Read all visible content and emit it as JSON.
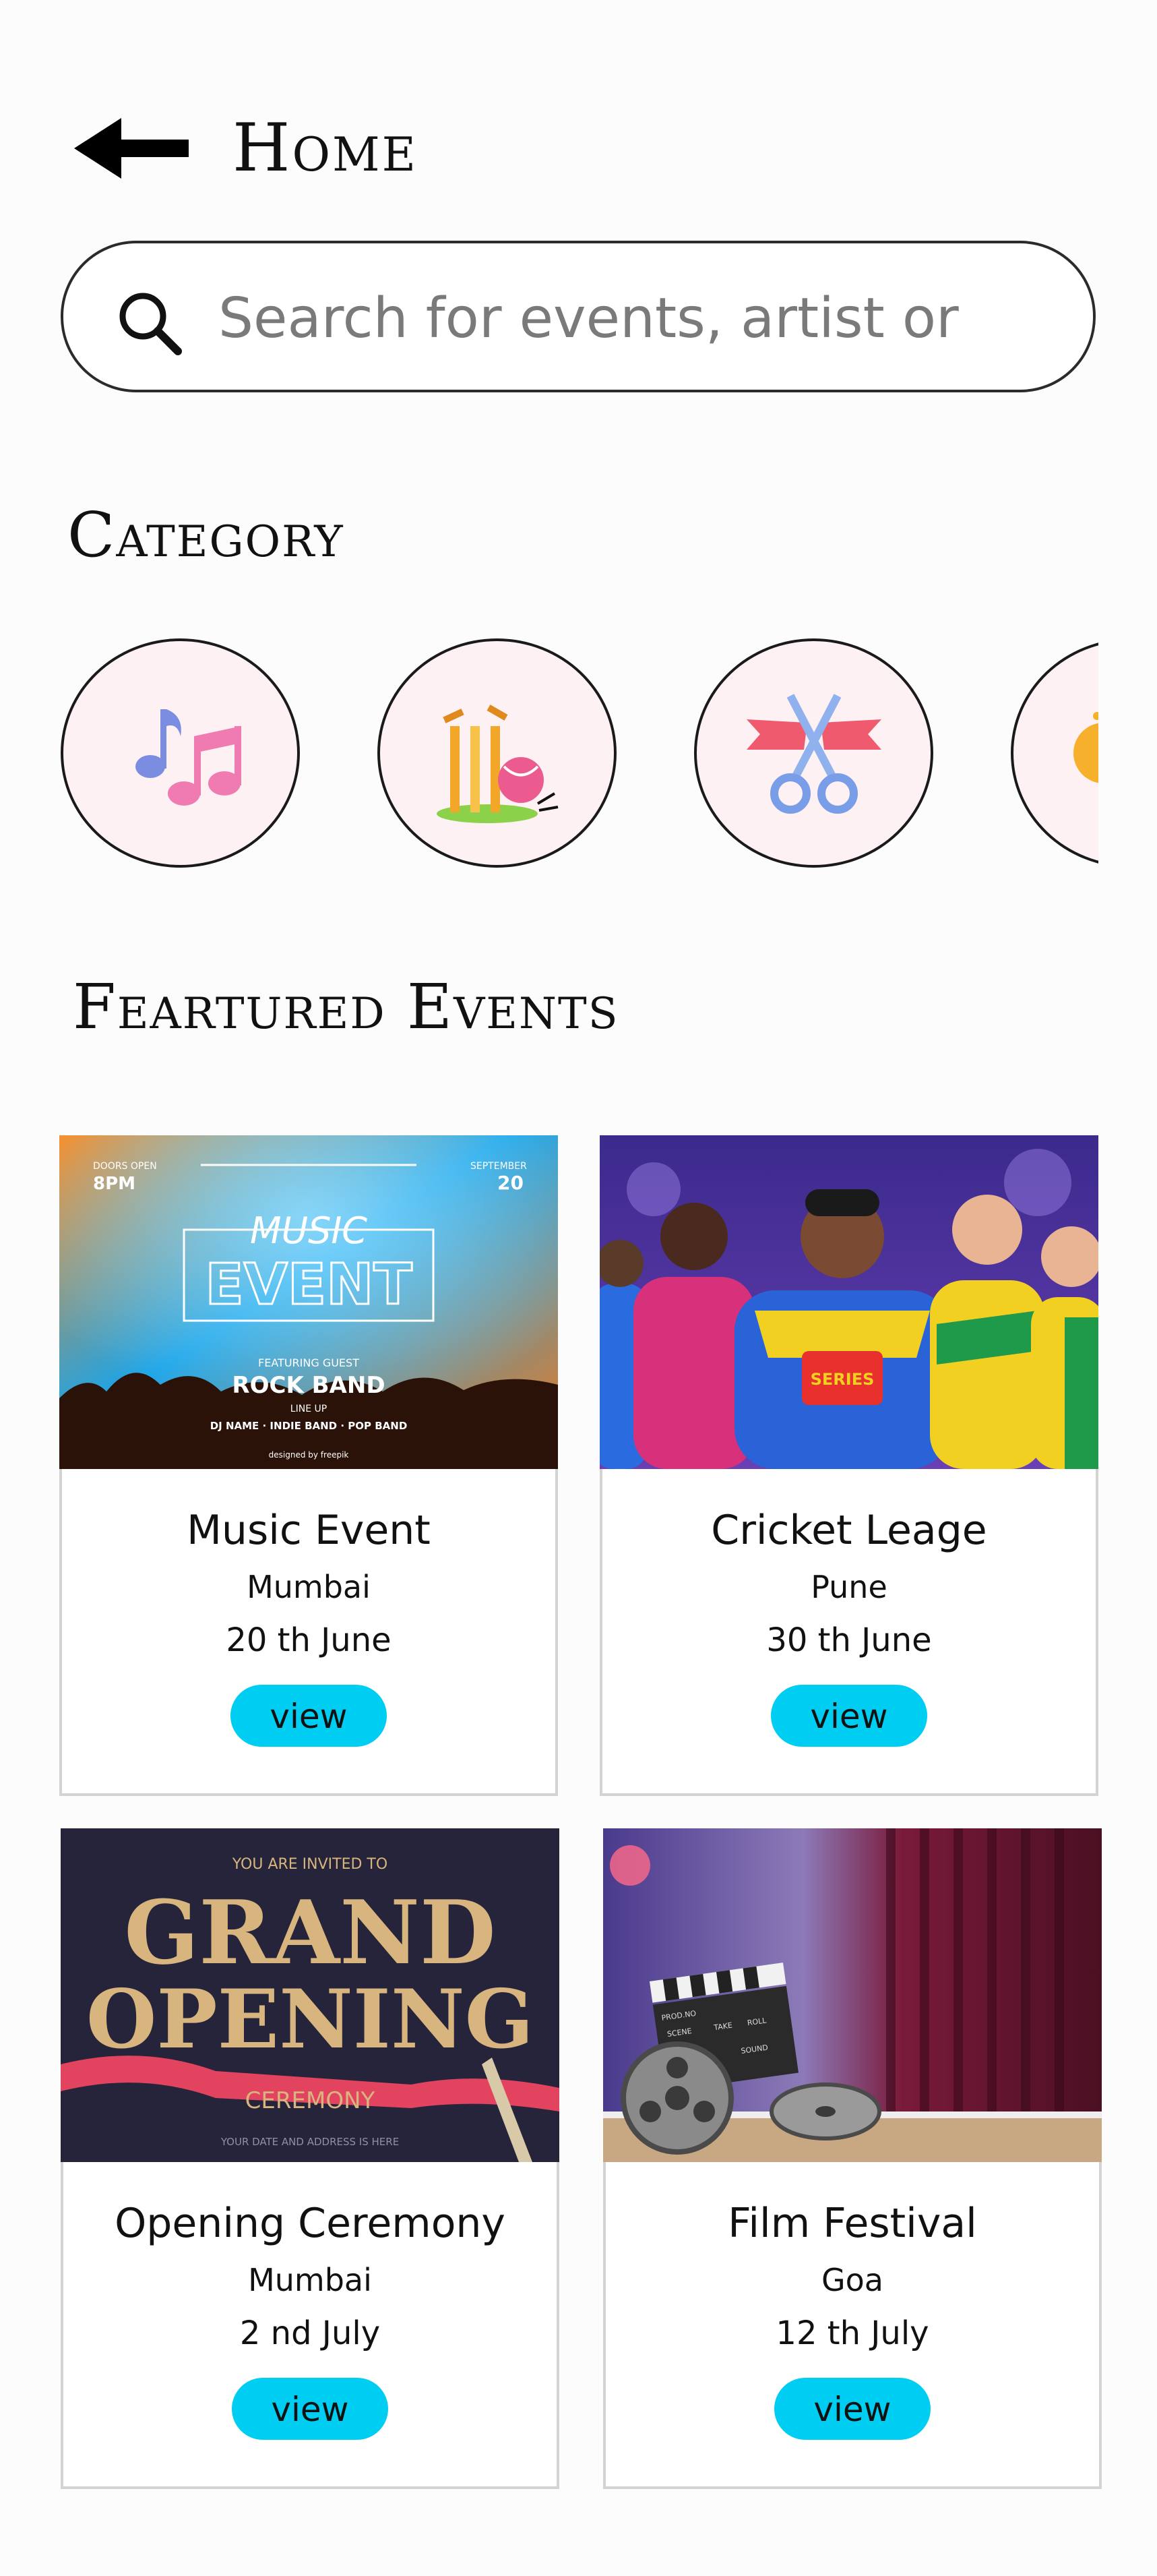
{
  "header": {
    "back_icon": "arrow-left-icon",
    "title": "Home"
  },
  "search": {
    "placeholder": "Search for events, artist or",
    "icon": "search-icon"
  },
  "category_section": {
    "title": "Category",
    "items": [
      {
        "icon": "music-notes-icon"
      },
      {
        "icon": "cricket-wickets-icon"
      },
      {
        "icon": "ribbon-cutting-icon"
      },
      {
        "icon": "comedy-mask-icon"
      }
    ]
  },
  "featured_section": {
    "title": "Feartured Events",
    "events": [
      {
        "name": "Music Event",
        "city": "Mumbai",
        "date": "20 th June",
        "button": "view",
        "poster": {
          "top_left_1": "DOORS OPEN",
          "top_left_2": "8PM",
          "top_right_1": "SEPTEMBER",
          "top_right_2": "20",
          "line1": "MUSIC",
          "line2": "EVENT",
          "featuring": "FEATURING GUEST",
          "band": "ROCK BAND",
          "lineup": "LINE UP",
          "lineup_names": "DJ NAME · INDIE BAND · POP BAND",
          "credit": "designed by freepik"
        }
      },
      {
        "name": "Cricket Leage",
        "city": "Pune",
        "date": "30 th June",
        "button": "view",
        "poster": {
          "jersey_text": "SERIES"
        }
      },
      {
        "name": "Opening Ceremony",
        "city": "Mumbai",
        "date": "2 nd July",
        "button": "view",
        "poster": {
          "invite": "YOU ARE INVITED TO",
          "line1": "GRAND",
          "line2": "OPENING",
          "ribbon": "CEREMONY",
          "footer": "YOUR DATE AND ADDRESS IS HERE"
        }
      },
      {
        "name": "Film Festival",
        "city": "Goa",
        "date": "12 th July",
        "button": "view",
        "poster": {
          "slate_1": "PROD.NO",
          "slate_2": "SCENE",
          "slate_3": "TAKE",
          "slate_4": "ROLL",
          "slate_5": "SOUND"
        }
      }
    ]
  },
  "colors": {
    "accent": "#00cdf2",
    "card_border": "#d3d3d3",
    "category_bg": "#fdf1f4"
  }
}
